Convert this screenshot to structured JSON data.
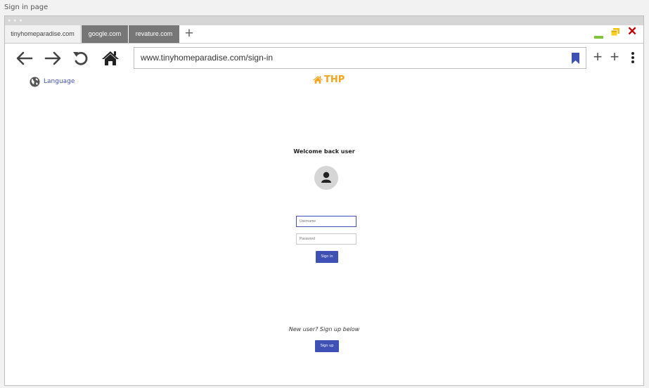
{
  "page_label": "Sign in page",
  "browser": {
    "tabs": [
      {
        "label": "tinyhomeparadise.com",
        "active": true
      },
      {
        "label": "google.com",
        "active": false
      },
      {
        "label": "revature.com",
        "active": false
      }
    ],
    "new_tab_label": "+",
    "close_label": "✕",
    "url": "www.tinyhomeparadise.com/sign-in",
    "toolbar_plus_1": "+",
    "toolbar_plus_2": "+"
  },
  "site": {
    "language_label": "Language",
    "logo_text": "THP",
    "logo_color": "#f2a51d",
    "accent_color": "#3f51b5"
  },
  "signin": {
    "heading": "Welcome back user",
    "username_placeholder": "Username",
    "password_placeholder": "Password",
    "signin_button": "Sign in",
    "new_user_text": "New user? Sign up below",
    "signup_button": "Sign up"
  },
  "icons": [
    "back-arrow-icon",
    "forward-arrow-icon",
    "refresh-icon",
    "home-icon",
    "bookmark-icon",
    "kebab-menu-icon",
    "globe-icon",
    "home-logo-icon",
    "user-avatar-icon",
    "minimize-icon",
    "maximize-icon",
    "close-icon"
  ]
}
